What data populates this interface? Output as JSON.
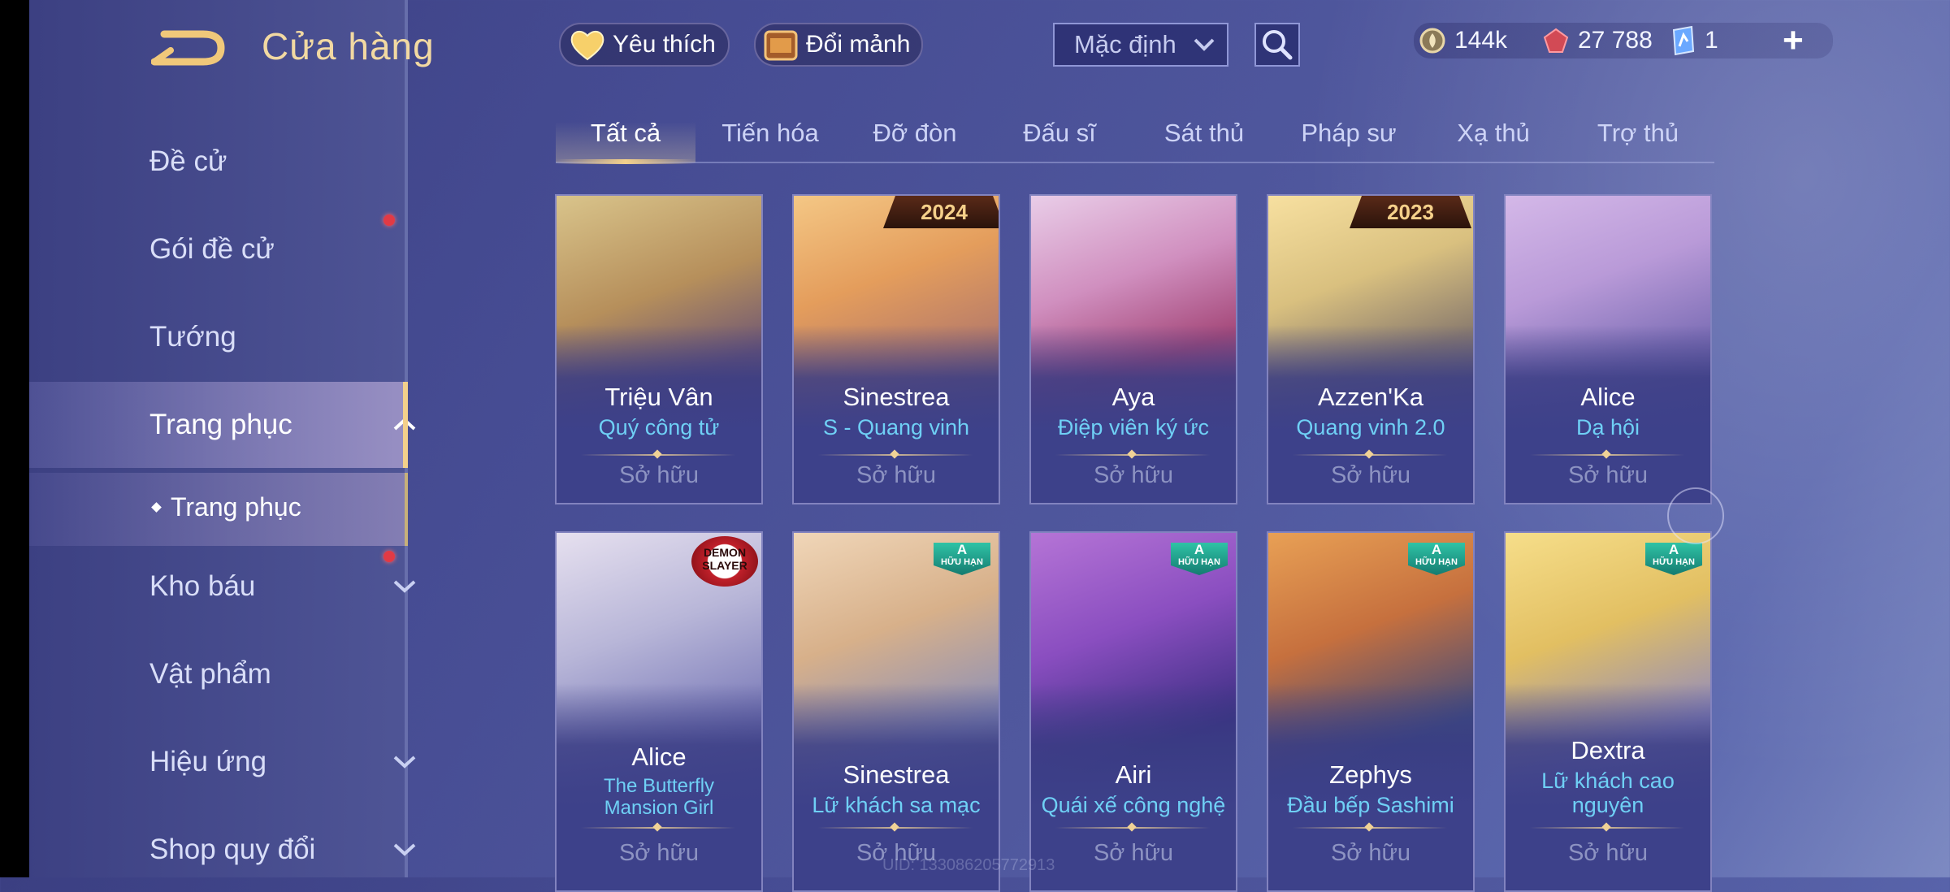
{
  "header": {
    "title": "Cửa hàng",
    "favorites_label": "Yêu thích",
    "exchange_label": "Đổi mảnh",
    "sort_value": "Mặc định"
  },
  "currencies": [
    {
      "name": "gold",
      "value": "144k"
    },
    {
      "name": "vouchers",
      "value": "27 788"
    },
    {
      "name": "crystal",
      "value": "1"
    }
  ],
  "sidebar": {
    "items": [
      {
        "label": "Đề cử",
        "dot": false
      },
      {
        "label": "Gói đề cử",
        "dot": true
      },
      {
        "label": "Tướng",
        "dot": false
      },
      {
        "label": "Trang phục",
        "expanded": true
      },
      {
        "label": "Kho báu",
        "dot": true,
        "chevron": "down"
      },
      {
        "label": "Vật phẩm"
      },
      {
        "label": "Hiệu ứng",
        "chevron": "down"
      },
      {
        "label": "Shop quy đổi",
        "chevron": "down"
      }
    ],
    "subitem": "Trang phục"
  },
  "tabs": [
    "Tất cả",
    "Tiến hóa",
    "Đỡ đòn",
    "Đấu sĩ",
    "Sát thủ",
    "Pháp sư",
    "Xạ thủ",
    "Trợ thủ"
  ],
  "active_tab": "Tất cả",
  "cards": [
    {
      "hero": "Triệu Vân",
      "skin": "Quý công tử",
      "status": "Sở hữu"
    },
    {
      "hero": "Sinestrea",
      "skin": "S - Quang vinh",
      "status": "Sở hữu",
      "banner": "2024"
    },
    {
      "hero": "Aya",
      "skin": "Điệp viên ký ức",
      "status": "Sở hữu"
    },
    {
      "hero": "Azzen'Ka",
      "skin": "Quang vinh 2.0",
      "status": "Sở hữu",
      "banner": "2023"
    },
    {
      "hero": "Alice",
      "skin": "Dạ hội",
      "status": "Sở hữu"
    },
    {
      "hero": "Alice",
      "skin": "The Butterfly Mansion Girl",
      "status": "Sở hữu",
      "badge": "DEMON SLAYER"
    },
    {
      "hero": "Sinestrea",
      "skin": "Lữ khách sa mạc",
      "status": "Sở hữu",
      "badge": "A"
    },
    {
      "hero": "Airi",
      "skin": "Quái xế công nghệ",
      "status": "Sở hữu",
      "badge": "A"
    },
    {
      "hero": "Zephys",
      "skin": "Đầu bếp Sashimi",
      "status": "Sở hữu",
      "badge": "A"
    },
    {
      "hero": "Dextra",
      "skin": "Lữ khách cao nguyên",
      "status": "Sở hữu",
      "badge": "A"
    }
  ],
  "badge_text": {
    "grade": "A",
    "limited": "HỮU HẠN"
  },
  "uid": "UID: 133086205772913",
  "colors": {
    "accent_gold": "#f3d08b",
    "skin_name_blue": "#6fd0f5",
    "owned_gray": "#8d93c2"
  }
}
